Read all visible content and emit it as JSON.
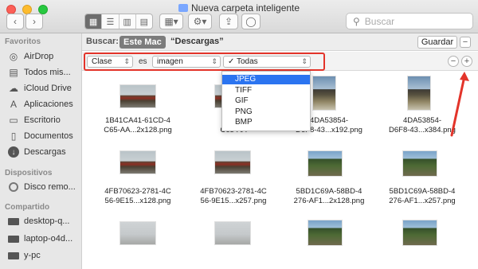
{
  "window": {
    "title": "Nueva carpeta inteligente"
  },
  "toolbar": {
    "view_icons": [
      "grid-view-icon",
      "list-view-icon",
      "column-view-icon",
      "gallery-view-icon"
    ],
    "search_placeholder": "Buscar"
  },
  "sidebar": {
    "sections": [
      {
        "heading": "Favoritos",
        "items": [
          "AirDrop",
          "Todos mis...",
          "iCloud Drive",
          "Aplicaciones",
          "Escritorio",
          "Documentos",
          "Descargas"
        ]
      },
      {
        "heading": "Dispositivos",
        "items": [
          "Disco remo..."
        ]
      },
      {
        "heading": "Compartido",
        "items": [
          "desktop-q...",
          "laptop-o4d...",
          "y-pc"
        ]
      }
    ]
  },
  "searchbar": {
    "label": "Buscar:",
    "scope_selected": "Este Mac",
    "scope_other": "“Descargas”",
    "save_label": "Guardar",
    "remove_label": "−"
  },
  "rule": {
    "attribute": "Clase",
    "operator": "es",
    "value": "imagen",
    "subvalue": "Todas",
    "remove_label": "−",
    "add_label": "+"
  },
  "menu": {
    "checked": "✓",
    "options": [
      "JPEG",
      "TIFF",
      "GIF",
      "PNG",
      "BMP"
    ],
    "selected_index": 0
  },
  "files": [
    {
      "name_line1": "1B41CA41-61CD-4",
      "name_line2": "C65-AA...2x128.png"
    },
    {
      "name_line1": "1B41C",
      "name_line2": "C65-AA"
    },
    {
      "name_line1": "4DA53854-",
      "name_line2": "D6F8-43...x192.png"
    },
    {
      "name_line1": "4DA53854-",
      "name_line2": "D6F8-43...x384.png"
    },
    {
      "name_line1": "4FB70623-2781-4C",
      "name_line2": "56-9E15...x128.png"
    },
    {
      "name_line1": "4FB70623-2781-4C",
      "name_line2": "56-9E15...x257.png"
    },
    {
      "name_line1": "5BD1C69A-58BD-4",
      "name_line2": "276-AF1...2x128.png"
    },
    {
      "name_line1": "5BD1C69A-58BD-4",
      "name_line2": "276-AF1...x257.png"
    },
    {
      "name_line1": "",
      "name_line2": ""
    },
    {
      "name_line1": "",
      "name_line2": ""
    },
    {
      "name_line1": "",
      "name_line2": ""
    },
    {
      "name_line1": "",
      "name_line2": ""
    }
  ],
  "colors": {
    "highlight": "#e3342a",
    "menu_selection": "#2b74f0",
    "scope_selected": "#7c7c7c"
  }
}
